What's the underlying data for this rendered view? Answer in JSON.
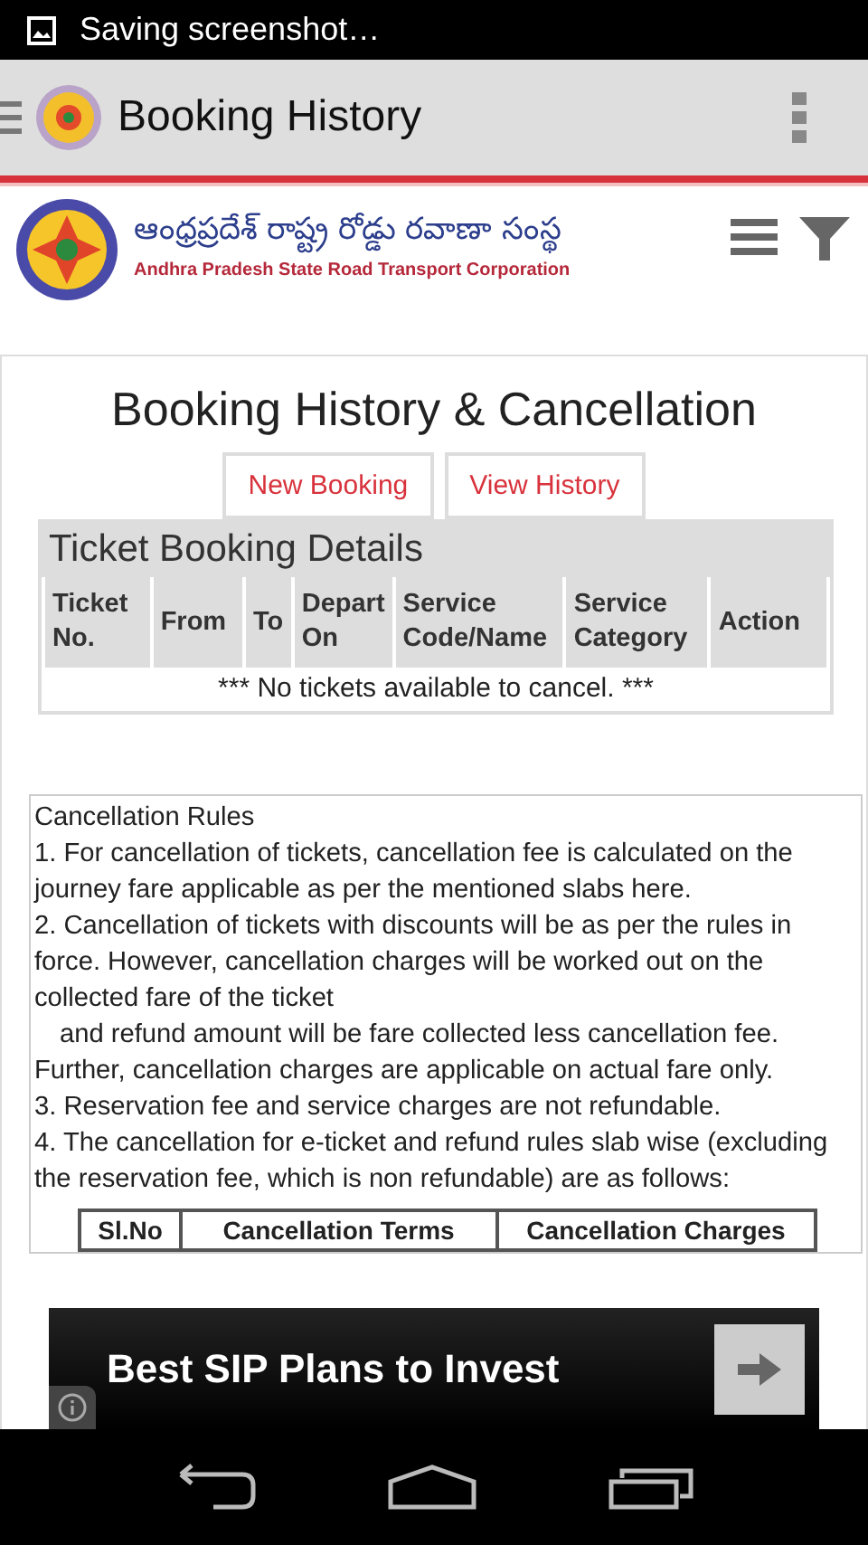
{
  "status_bar": {
    "notification": "Saving screenshot…"
  },
  "action_bar": {
    "title": "Booking History"
  },
  "site_header": {
    "telugu_name": "ఆంధ్రప్రదేశ్ రాష్ట్ర రోడ్డు రవాణా సంస్థ",
    "english_name": "Andhra Pradesh State Road Transport Corporation"
  },
  "page_title": "Booking History & Cancellation",
  "tabs": [
    {
      "label": "New Booking",
      "selected": false
    },
    {
      "label": "View History",
      "selected": false
    }
  ],
  "booking_table": {
    "caption": "Ticket Booking Details",
    "columns": [
      "Ticket No.",
      "From",
      "To",
      "Depart On",
      "Service Code/Name",
      "Service Category",
      "Action"
    ],
    "empty_message": "*** No tickets available to cancel. ***"
  },
  "rules": {
    "heading": "Cancellation Rules",
    "paragraphs": [
      {
        "text": "1. For cancellation of tickets, cancellation fee is calculated on the journey fare applicable as per the mentioned slabs here.",
        "indented": false
      },
      {
        "text": "2. Cancellation of tickets with discounts will be as per the rules in force. However, cancellation charges will be worked out on the collected fare of the ticket",
        "indented": false
      },
      {
        "text": "and refund amount will be fare collected less cancellation fee. Further, cancellation charges are applicable on actual fare only.",
        "indented": true
      },
      {
        "text": "3. Reservation fee and service charges are not refundable.",
        "indented": false
      },
      {
        "text": "4. The cancellation for e-ticket and refund rules slab wise (excluding the reservation fee, which is non refundable) are as follows:",
        "indented": false
      }
    ],
    "table_columns": [
      "Sl.No",
      "Cancellation Terms",
      "Cancellation Charges"
    ]
  },
  "ad": {
    "text": "Best SIP Plans to Invest"
  }
}
